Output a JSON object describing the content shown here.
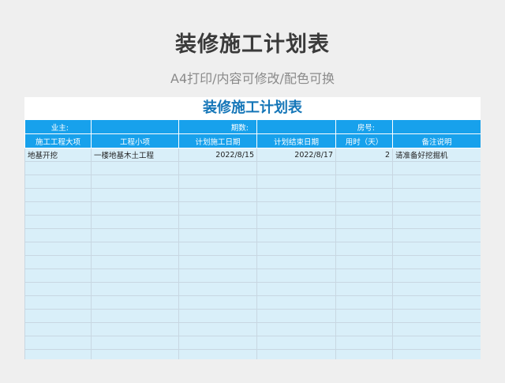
{
  "header": {
    "title": "装修施工计划表",
    "subtitle": "A4打印/内容可修改/配色可换"
  },
  "sheet": {
    "title": "装修施工计划表",
    "info": {
      "owner_label": "业主:",
      "period_label": "期数:",
      "room_label": "房号:"
    },
    "columns": [
      "施工工程大项",
      "工程小项",
      "计划施工日期",
      "计划结束日期",
      "用时（天）",
      "备注说明"
    ],
    "rows": [
      [
        "地基开挖",
        "一楼地基木土工程",
        "2022/8/15",
        "2022/8/17",
        "2",
        "请准备好挖掘机"
      ]
    ],
    "empty_row_count": 15
  },
  "colors": {
    "header_blue": "#17a1ec",
    "row_light_blue": "#d9eff9",
    "title_blue": "#1576b8"
  }
}
